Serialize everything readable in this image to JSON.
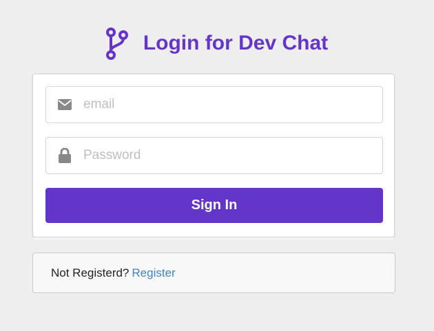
{
  "header": {
    "title": "Login for Dev Chat",
    "logo_icon": "code-branch-icon"
  },
  "form": {
    "email": {
      "icon": "envelope-icon",
      "placeholder": "email",
      "value": ""
    },
    "password": {
      "icon": "lock-icon",
      "placeholder": "Password",
      "value": ""
    },
    "submit_label": "Sign In"
  },
  "footer_message": {
    "text": "Not Registerd?",
    "link_label": "Register"
  },
  "colors": {
    "accent": "#6435c9",
    "link": "#4183c4",
    "background": "#eeeeee"
  }
}
